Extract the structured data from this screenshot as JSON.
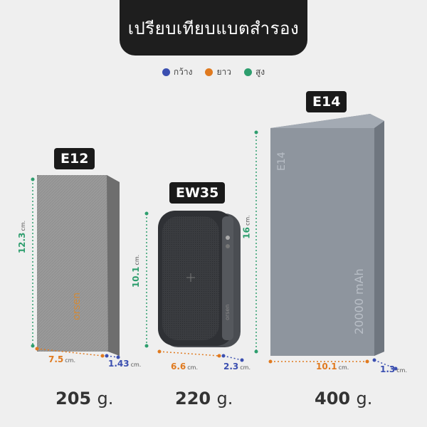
{
  "title": "เปรียบเทียบแบตสำรอง",
  "legend": [
    {
      "label": "กว้าง",
      "color": "#3b4fb0"
    },
    {
      "label": "ยาว",
      "color": "#e07a1f"
    },
    {
      "label": "สูง",
      "color": "#2e9e6e"
    }
  ],
  "products": {
    "e12": {
      "name": "E12",
      "brand_text": "orsen",
      "height": "12.3",
      "width": "7.5",
      "depth": "1.43",
      "unit": "cm.",
      "weight_value": "205",
      "weight_unit": "g."
    },
    "ew35": {
      "name": "EW35",
      "brand_text": "orsen",
      "height": "10.1",
      "width": "6.6",
      "depth": "2.3",
      "unit": "cm.",
      "weight_value": "220",
      "weight_unit": "g."
    },
    "e14": {
      "name": "E14",
      "model_print": "E14",
      "capacity_print": "20000 mAh",
      "height": "16",
      "width": "10.1",
      "depth": "1.3",
      "unit": "cm.",
      "weight_value": "400",
      "weight_unit": "g."
    }
  }
}
